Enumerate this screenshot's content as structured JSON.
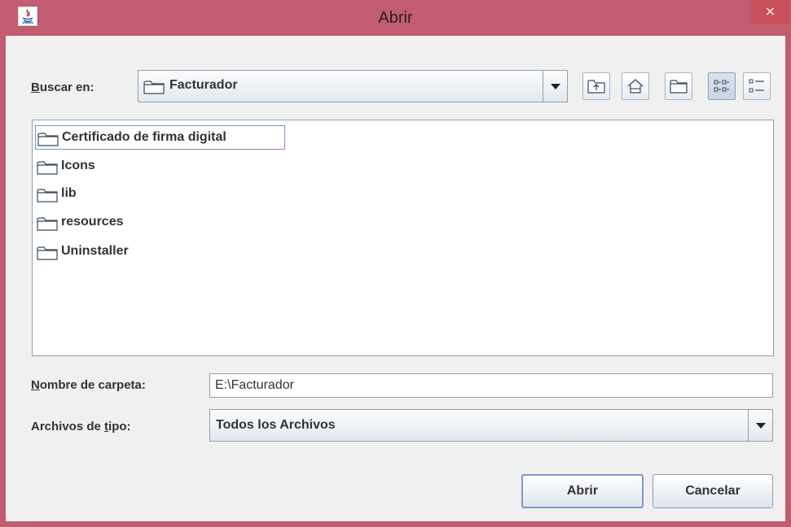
{
  "window": {
    "title": "Abrir",
    "close_glyph": "×",
    "title_bar_color": "#c25d71"
  },
  "toolbar": {
    "look_in_label": "Buscar en:",
    "look_in_mnemonic": "B",
    "look_in_value": "Facturador",
    "buttons": [
      {
        "name": "up-one-level",
        "icon": "folder-up-icon"
      },
      {
        "name": "home",
        "icon": "home-icon"
      },
      {
        "name": "new-folder",
        "icon": "new-folder-icon"
      },
      {
        "name": "list-view",
        "icon": "list-view-icon",
        "selected": true
      },
      {
        "name": "details-view",
        "icon": "details-view-icon",
        "selected": false
      }
    ]
  },
  "file_list": {
    "items": [
      {
        "label": "Certificado de firma digital",
        "type": "folder",
        "focused": true
      },
      {
        "label": "Icons",
        "type": "folder",
        "focused": false
      },
      {
        "label": "lib",
        "type": "folder",
        "focused": false
      },
      {
        "label": "resources",
        "type": "folder",
        "focused": false
      },
      {
        "label": "Uninstaller",
        "type": "folder",
        "focused": false
      }
    ]
  },
  "folder_name": {
    "label": "Nombre de carpeta:",
    "mnemonic": "N",
    "value": "E:\\Facturador"
  },
  "file_type": {
    "label": "Archivos de tipo:",
    "mnemonic": "t",
    "value": "Todos los Archivos"
  },
  "buttons": {
    "open_label": "Abrir",
    "cancel_label": "Cancelar"
  }
}
